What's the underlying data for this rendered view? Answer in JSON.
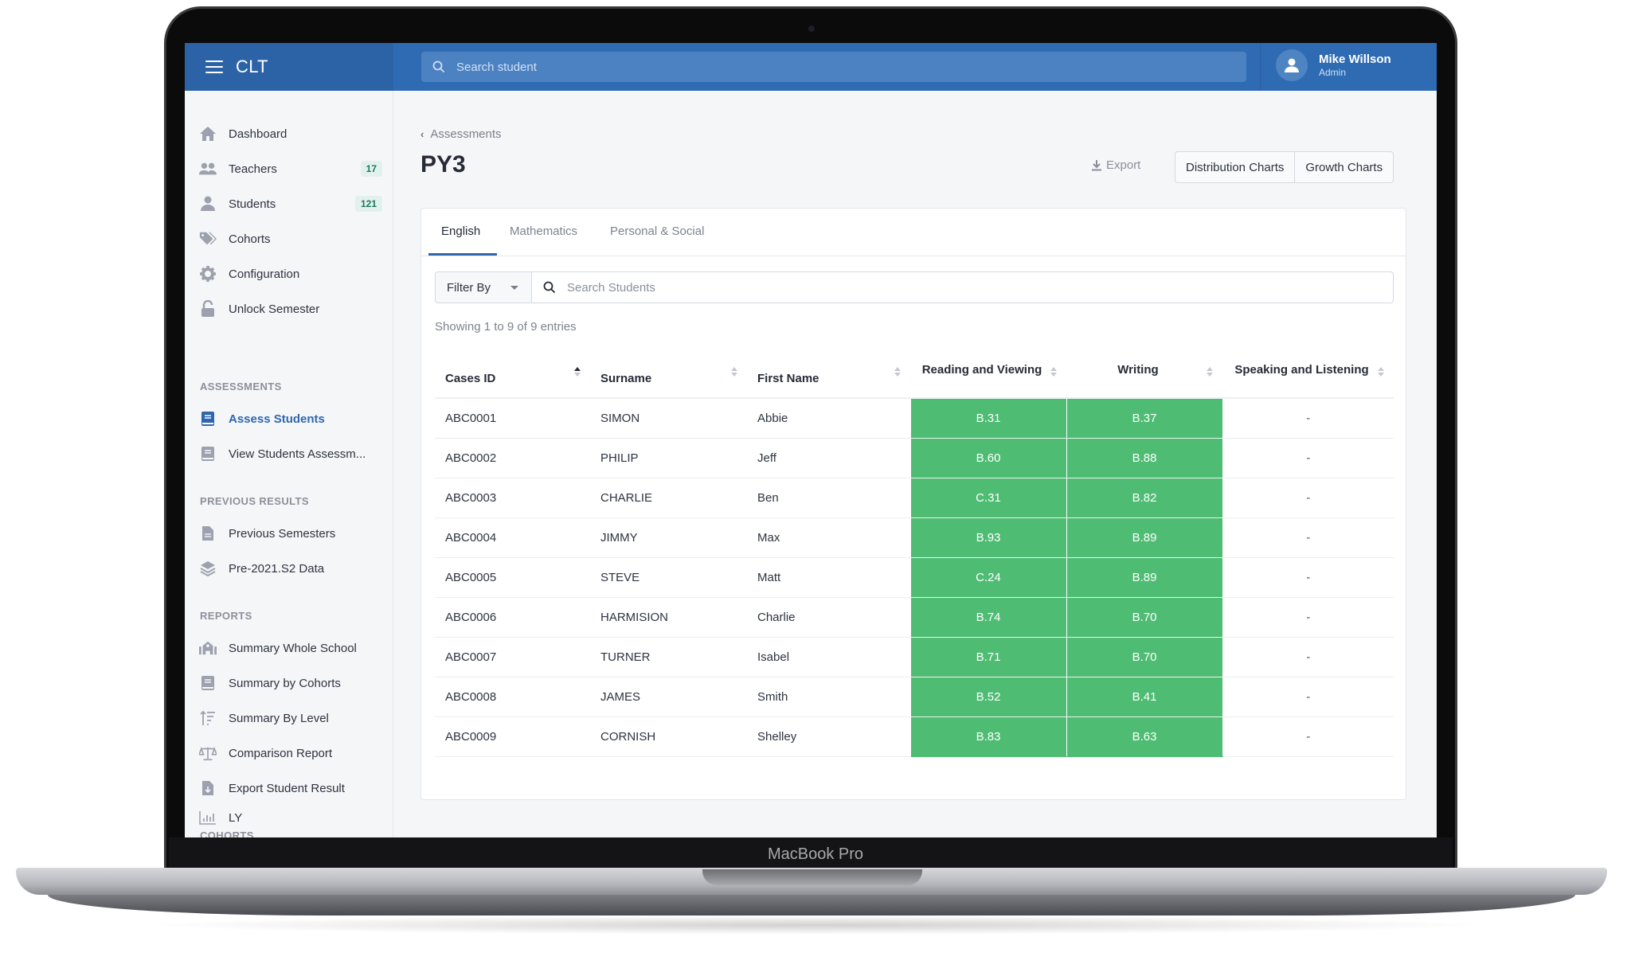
{
  "device": {
    "brand_label": "MacBook Pro"
  },
  "header": {
    "app_title": "CLT",
    "search_placeholder": "Search student",
    "user": {
      "name": "Mike Willson",
      "role": "Admin"
    }
  },
  "sidebar": {
    "main_items": [
      {
        "label": "Dashboard",
        "icon": "home-icon"
      },
      {
        "label": "Teachers",
        "icon": "users-icon",
        "badge": "17"
      },
      {
        "label": "Students",
        "icon": "user-icon",
        "badge": "121"
      },
      {
        "label": "Cohorts",
        "icon": "tags-icon"
      },
      {
        "label": "Configuration",
        "icon": "gear-icon"
      },
      {
        "label": "Unlock Semester",
        "icon": "unlock-icon"
      }
    ],
    "sections": {
      "assessments": "ASSESSMENTS",
      "previous_results": "PREVIOUS RESULTS",
      "reports": "REPORTS",
      "cohorts": "COHORTS"
    },
    "assessment_items": [
      {
        "label": "Assess Students",
        "icon": "book-icon",
        "active": true
      },
      {
        "label": "View Students Assessm...",
        "icon": "book-icon"
      }
    ],
    "previous_items": [
      {
        "label": "Previous Semesters",
        "icon": "file-icon"
      },
      {
        "label": "Pre-2021.S2 Data",
        "icon": "layers-icon"
      }
    ],
    "report_items": [
      {
        "label": "Summary Whole School",
        "icon": "school-icon"
      },
      {
        "label": "Summary by Cohorts",
        "icon": "book-icon"
      },
      {
        "label": "Summary By Level",
        "icon": "sort-amount-icon"
      },
      {
        "label": "Comparison Report",
        "icon": "balance-scale-icon"
      },
      {
        "label": "Export Student Result",
        "icon": "file-download-icon"
      }
    ],
    "cohort_items": [
      {
        "label": "LY",
        "icon": "bar-chart-icon"
      }
    ]
  },
  "main": {
    "breadcrumb": "Assessments",
    "title": "PY3",
    "export_label": "Export",
    "buttons": {
      "distribution": "Distribution Charts",
      "growth": "Growth Charts"
    },
    "tabs": [
      {
        "label": "English",
        "active": true
      },
      {
        "label": "Mathematics"
      },
      {
        "label": "Personal & Social"
      }
    ],
    "filter_label": "Filter By",
    "search_placeholder": "Search Students",
    "showing": "Showing 1 to 9 of 9 entries",
    "colors": {
      "grade_green": "#4fbc74",
      "accent_blue": "#2f67ae"
    },
    "table": {
      "columns": [
        {
          "label": "Cases ID",
          "sort": "asc"
        },
        {
          "label": "Surname",
          "sort": "none"
        },
        {
          "label": "First Name",
          "sort": "none"
        },
        {
          "label": "Reading and Viewing",
          "sort": "none"
        },
        {
          "label": "Writing",
          "sort": "none"
        },
        {
          "label": "Speaking and Listening",
          "sort": "none"
        }
      ],
      "rows": [
        {
          "id": "ABC0001",
          "surname": "SIMON",
          "first": "Abbie",
          "reading": "B.31",
          "writing": "B.37",
          "speaking": "-"
        },
        {
          "id": "ABC0002",
          "surname": "PHILIP",
          "first": "Jeff",
          "reading": "B.60",
          "writing": "B.88",
          "speaking": "-"
        },
        {
          "id": "ABC0003",
          "surname": "CHARLIE",
          "first": "Ben",
          "reading": "C.31",
          "writing": "B.82",
          "speaking": "-"
        },
        {
          "id": "ABC0004",
          "surname": "JIMMY",
          "first": "Max",
          "reading": "B.93",
          "writing": "B.89",
          "speaking": "-"
        },
        {
          "id": "ABC0005",
          "surname": "STEVE",
          "first": "Matt",
          "reading": "C.24",
          "writing": "B.89",
          "speaking": "-"
        },
        {
          "id": "ABC0006",
          "surname": "HARMISION",
          "first": "Charlie",
          "reading": "B.74",
          "writing": "B.70",
          "speaking": "-"
        },
        {
          "id": "ABC0007",
          "surname": "TURNER",
          "first": "Isabel",
          "reading": "B.71",
          "writing": "B.70",
          "speaking": "-"
        },
        {
          "id": "ABC0008",
          "surname": "JAMES",
          "first": "Smith",
          "reading": "B.52",
          "writing": "B.41",
          "speaking": "-"
        },
        {
          "id": "ABC0009",
          "surname": "CORNISH",
          "first": "Shelley",
          "reading": "B.83",
          "writing": "B.63",
          "speaking": "-"
        }
      ]
    }
  }
}
